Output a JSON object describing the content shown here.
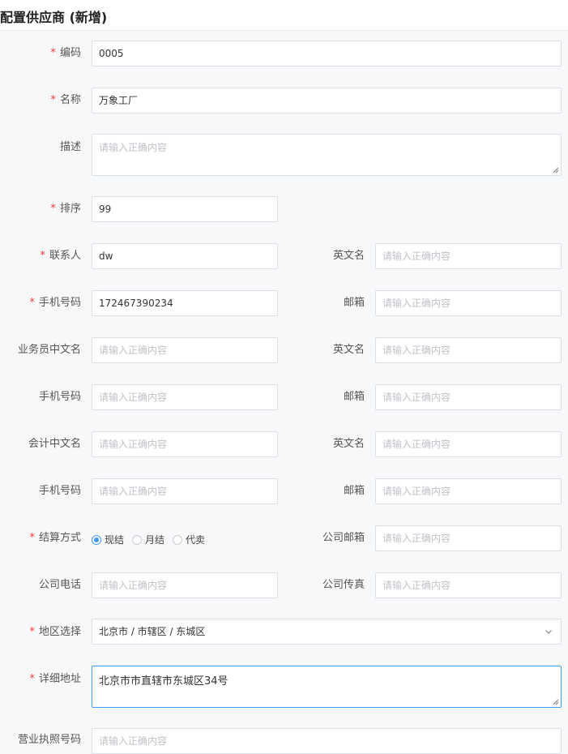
{
  "page": {
    "title": "配置供应商 (新增)"
  },
  "placeholder": "请输入正确内容",
  "required_mark": "*",
  "form": {
    "code": {
      "label": "编码",
      "value": "0005"
    },
    "name": {
      "label": "名称",
      "value": "万象工厂"
    },
    "description": {
      "label": "描述",
      "value": ""
    },
    "sort": {
      "label": "排序",
      "value": "99"
    },
    "contact": {
      "label": "联系人",
      "value": "dw"
    },
    "contact_en": {
      "label": "英文名",
      "value": ""
    },
    "contact_mobile": {
      "label": "手机号码",
      "value": "172467390234"
    },
    "contact_email": {
      "label": "邮箱",
      "value": ""
    },
    "sales_cn": {
      "label": "业务员中文名",
      "value": ""
    },
    "sales_en": {
      "label": "英文名",
      "value": ""
    },
    "sales_mobile": {
      "label": "手机号码",
      "value": ""
    },
    "sales_email": {
      "label": "邮箱",
      "value": ""
    },
    "accountant_cn": {
      "label": "会计中文名",
      "value": ""
    },
    "accountant_en": {
      "label": "英文名",
      "value": ""
    },
    "accountant_mobile": {
      "label": "手机号码",
      "value": ""
    },
    "accountant_email": {
      "label": "邮箱",
      "value": ""
    },
    "settlement": {
      "label": "结算方式",
      "options": [
        "现结",
        "月结",
        "代卖"
      ],
      "selected": "现结"
    },
    "company_email": {
      "label": "公司邮箱",
      "value": ""
    },
    "company_phone": {
      "label": "公司电话",
      "value": ""
    },
    "company_fax": {
      "label": "公司传真",
      "value": ""
    },
    "region": {
      "label": "地区选择",
      "value": "北京市 / 市辖区 / 东城区"
    },
    "address": {
      "label": "详细地址",
      "value": "北京市市直辖市东城区34号"
    },
    "license": {
      "label": "营业执照号码",
      "value": ""
    }
  },
  "colors": {
    "accent": "#409eff",
    "required": "#f23c3c",
    "border": "#dcdfe6"
  }
}
